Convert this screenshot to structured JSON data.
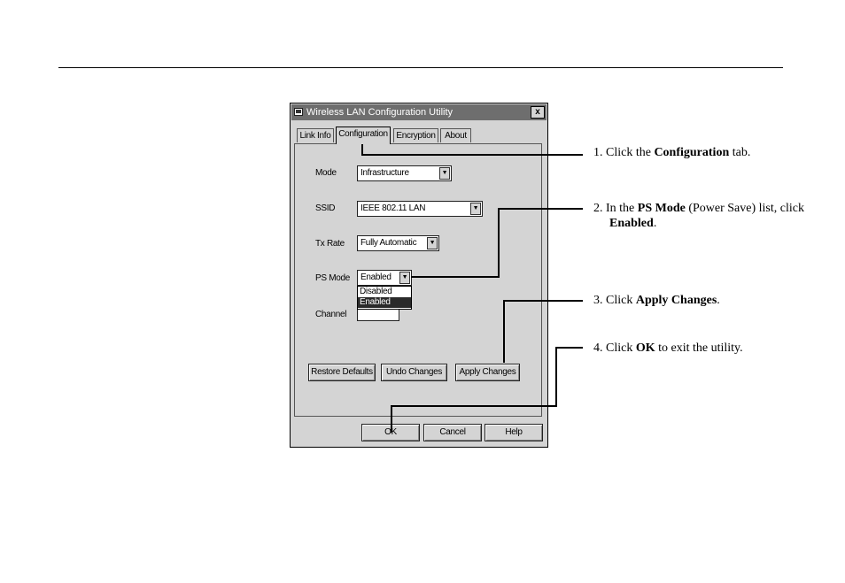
{
  "window": {
    "title": "Wireless LAN Configuration Utility",
    "close_glyph": "x",
    "tabs": [
      "Link Info",
      "Configuration",
      "Encryption",
      "About"
    ],
    "active_tab": "Configuration"
  },
  "form": {
    "mode": {
      "label": "Mode",
      "value": "Infrastructure"
    },
    "ssid": {
      "label": "SSID",
      "value": "IEEE 802.11 LAN"
    },
    "tx_rate": {
      "label": "Tx Rate",
      "value": "Fully Automatic"
    },
    "ps_mode": {
      "label": "PS Mode",
      "value": "Enabled",
      "options": [
        "Disabled",
        "Enabled"
      ],
      "highlighted_option": "Enabled"
    },
    "channel": {
      "label": "Channel",
      "value": ""
    }
  },
  "panel_buttons": {
    "restore": "Restore Defaults",
    "undo": "Undo Changes",
    "apply": "Apply Changes"
  },
  "dialog_buttons": {
    "ok": "OK",
    "cancel": "Cancel",
    "help": "Help"
  },
  "steps": [
    {
      "prefix": "1. Click the ",
      "bold": "Configuration",
      "suffix": " tab."
    },
    {
      "prefix": "2. In the ",
      "bold": "PS Mode",
      "suffix": " (Power Save) list, click",
      "line2_bold": "Enabled",
      "line2_suffix": "."
    },
    {
      "prefix": "3. Click ",
      "bold": "Apply Changes",
      "suffix": "."
    },
    {
      "prefix": "4. Click ",
      "bold": "OK",
      "suffix": " to exit the utility."
    }
  ]
}
